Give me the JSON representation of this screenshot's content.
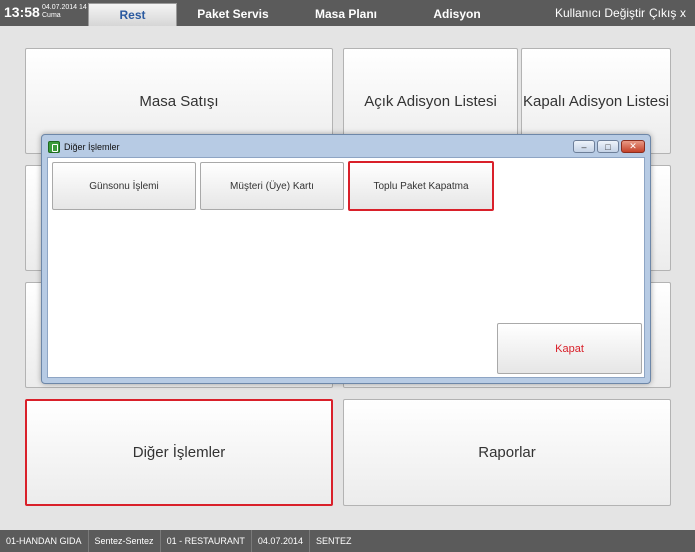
{
  "header": {
    "time": "13:58",
    "date": "04.07.2014 14",
    "day": "Cuma",
    "tabs": [
      {
        "label": "Rest",
        "active": true
      },
      {
        "label": "Paket Servis",
        "active": false
      },
      {
        "label": "Masa Planı",
        "active": false
      },
      {
        "label": "Adisyon",
        "active": false
      }
    ],
    "user_switch": "Kullanıcı Değiştir",
    "logout": "Çıkış",
    "close_glyph": "x"
  },
  "tiles": {
    "masa_satisi": "Masa Satışı",
    "acik_adisyon": "Açık Adisyon Listesi",
    "kapali_adisyon": "Kapalı Adisyon Listesi",
    "diger_islemler": "Diğer İşlemler",
    "raporlar": "Raporlar"
  },
  "dialog": {
    "title": "Diğer İşlemler",
    "buttons": {
      "gunsonu": "Günsonu İşlemi",
      "musteri": "Müşteri (Üye) Kartı",
      "toplu_paket": "Toplu Paket Kapatma",
      "kapat": "Kapat"
    },
    "window_controls": {
      "minimize": "–",
      "maximize": "□",
      "close": "✕"
    }
  },
  "status": {
    "items": [
      "01-HANDAN GIDA",
      "Sentez-Sentez",
      "01 - RESTAURANT",
      "04.07.2014",
      "SENTEZ"
    ]
  },
  "colors": {
    "accent_red": "#d9202a",
    "bar_gray": "#5b5b5b",
    "active_tab_text": "#2b5aa0",
    "dialog_frame": "#b7cbe4"
  }
}
